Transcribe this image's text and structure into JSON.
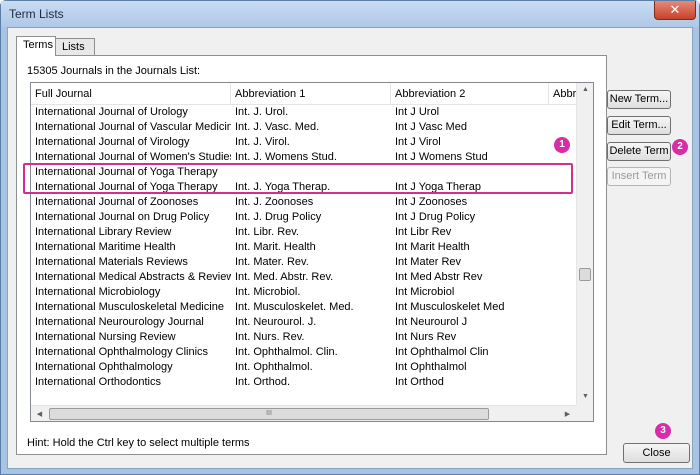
{
  "window": {
    "title": "Term Lists",
    "close_glyph": "✕"
  },
  "tabs": [
    {
      "label": "Terms"
    },
    {
      "label": "Lists"
    }
  ],
  "list": {
    "count_label": "15305 Journals in the Journals List:",
    "columns": [
      "Full Journal",
      "Abbreviation 1",
      "Abbreviation 2",
      "Abbre"
    ],
    "rows": [
      [
        "International Journal of Urology",
        "Int. J. Urol.",
        "Int J Urol"
      ],
      [
        "International Journal of Vascular Medicine",
        "Int. J. Vasc. Med.",
        "Int J Vasc Med"
      ],
      [
        "International Journal of Virology",
        "Int. J. Virol.",
        "Int J Virol"
      ],
      [
        "International Journal of Women's Studies",
        "Int. J. Womens Stud.",
        "Int J Womens Stud"
      ],
      [
        "International Journal of Yoga Therapy",
        "",
        ""
      ],
      [
        "International Journal of Yoga Therapy",
        "Int. J. Yoga Therap.",
        "Int J Yoga Therap"
      ],
      [
        "International Journal of Zoonoses",
        "Int. J. Zoonoses",
        "Int J Zoonoses"
      ],
      [
        "International Journal on Drug Policy",
        "Int. J. Drug Policy",
        "Int J Drug Policy"
      ],
      [
        "International Library Review",
        "Int. Libr. Rev.",
        "Int Libr Rev"
      ],
      [
        "International Maritime Health",
        "Int. Marit. Health",
        "Int Marit Health"
      ],
      [
        "International Materials Reviews",
        "Int. Mater. Rev.",
        "Int Mater Rev"
      ],
      [
        "International Medical Abstracts & Reviews",
        "Int. Med. Abstr. Rev.",
        "Int Med Abstr Rev"
      ],
      [
        "International Microbiology",
        "Int. Microbiol.",
        "Int Microbiol"
      ],
      [
        "International Musculoskeletal Medicine",
        "Int. Musculoskelet. Med.",
        "Int Musculoskelet Med"
      ],
      [
        "International Neurourology Journal",
        "Int. Neurourol. J.",
        "Int Neurourol J"
      ],
      [
        "International Nursing Review",
        "Int. Nurs. Rev.",
        "Int Nurs Rev"
      ],
      [
        "International Ophthalmology Clinics",
        "Int. Ophthalmol. Clin.",
        "Int Ophthalmol Clin"
      ],
      [
        "International Ophthalmology",
        "Int. Ophthalmol.",
        "Int Ophthalmol"
      ],
      [
        "International Orthodontics",
        "Int. Orthod.",
        "Int Orthod"
      ]
    ],
    "hscroll_thumb_glyph": "III",
    "hint": "Hint: Hold the Ctrl key to select multiple terms"
  },
  "buttons": {
    "new_term": "New Term...",
    "edit_term": "Edit Term...",
    "delete_term": "Delete Term",
    "insert_term": "Insert Term",
    "close": "Close"
  },
  "callouts": {
    "one": "1",
    "two": "2",
    "three": "3"
  },
  "colors": {
    "callout": "#d62ea9",
    "highlight_border": "#d62e8f"
  }
}
